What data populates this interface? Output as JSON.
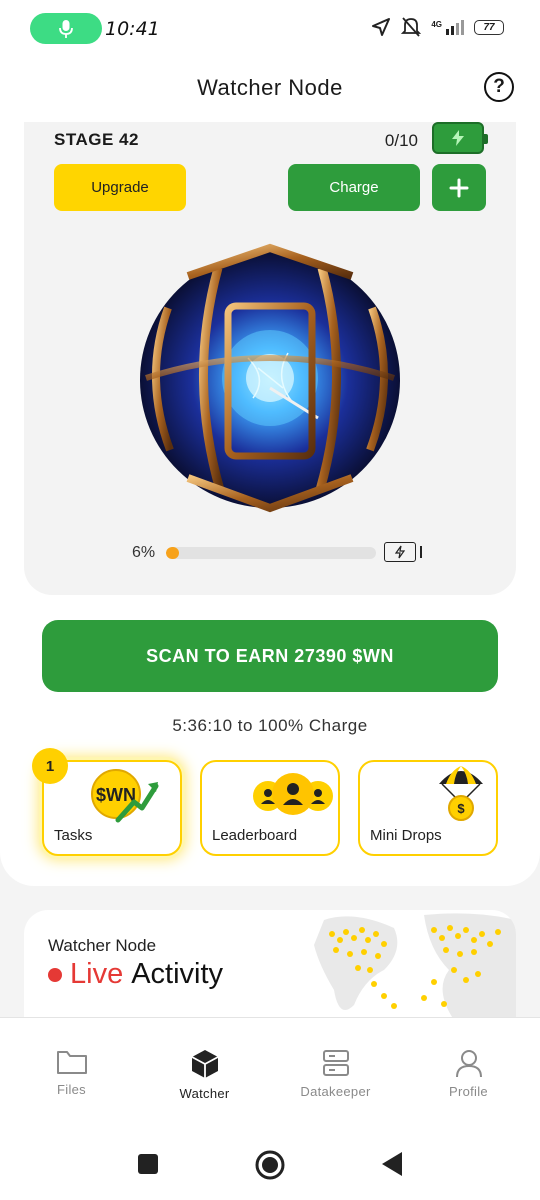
{
  "status_bar": {
    "time": "10:41",
    "network": "4G",
    "battery": "77"
  },
  "header": {
    "title": "Watcher Node"
  },
  "stage": {
    "label": "STAGE 42",
    "charges": "0/10",
    "upgrade_label": "Upgrade",
    "charge_label": "Charge",
    "progress_text": "6%",
    "progress_value": 0.06
  },
  "scan": {
    "button_label": "SCAN TO EARN 27390 $WN",
    "charge_time": "5:36:10 to 100% Charge"
  },
  "tiles": [
    {
      "label": "Tasks",
      "badge": "1",
      "icon_text": "$WN"
    },
    {
      "label": "Leaderboard"
    },
    {
      "label": "Mini Drops"
    }
  ],
  "activity": {
    "subtitle": "Watcher Node",
    "live_word": "Live",
    "title_rest": "Activity"
  },
  "nav": {
    "items": [
      {
        "label": "Files",
        "icon": "folder-icon"
      },
      {
        "label": "Watcher",
        "icon": "cube-icon"
      },
      {
        "label": "Datakeeper",
        "icon": "server-icon"
      },
      {
        "label": "Profile",
        "icon": "user-icon"
      }
    ],
    "active": "Watcher"
  },
  "colors": {
    "green": "#2e9c3c",
    "yellow": "#ffd500",
    "orange": "#f7a21b",
    "live_red": "#e53935"
  }
}
